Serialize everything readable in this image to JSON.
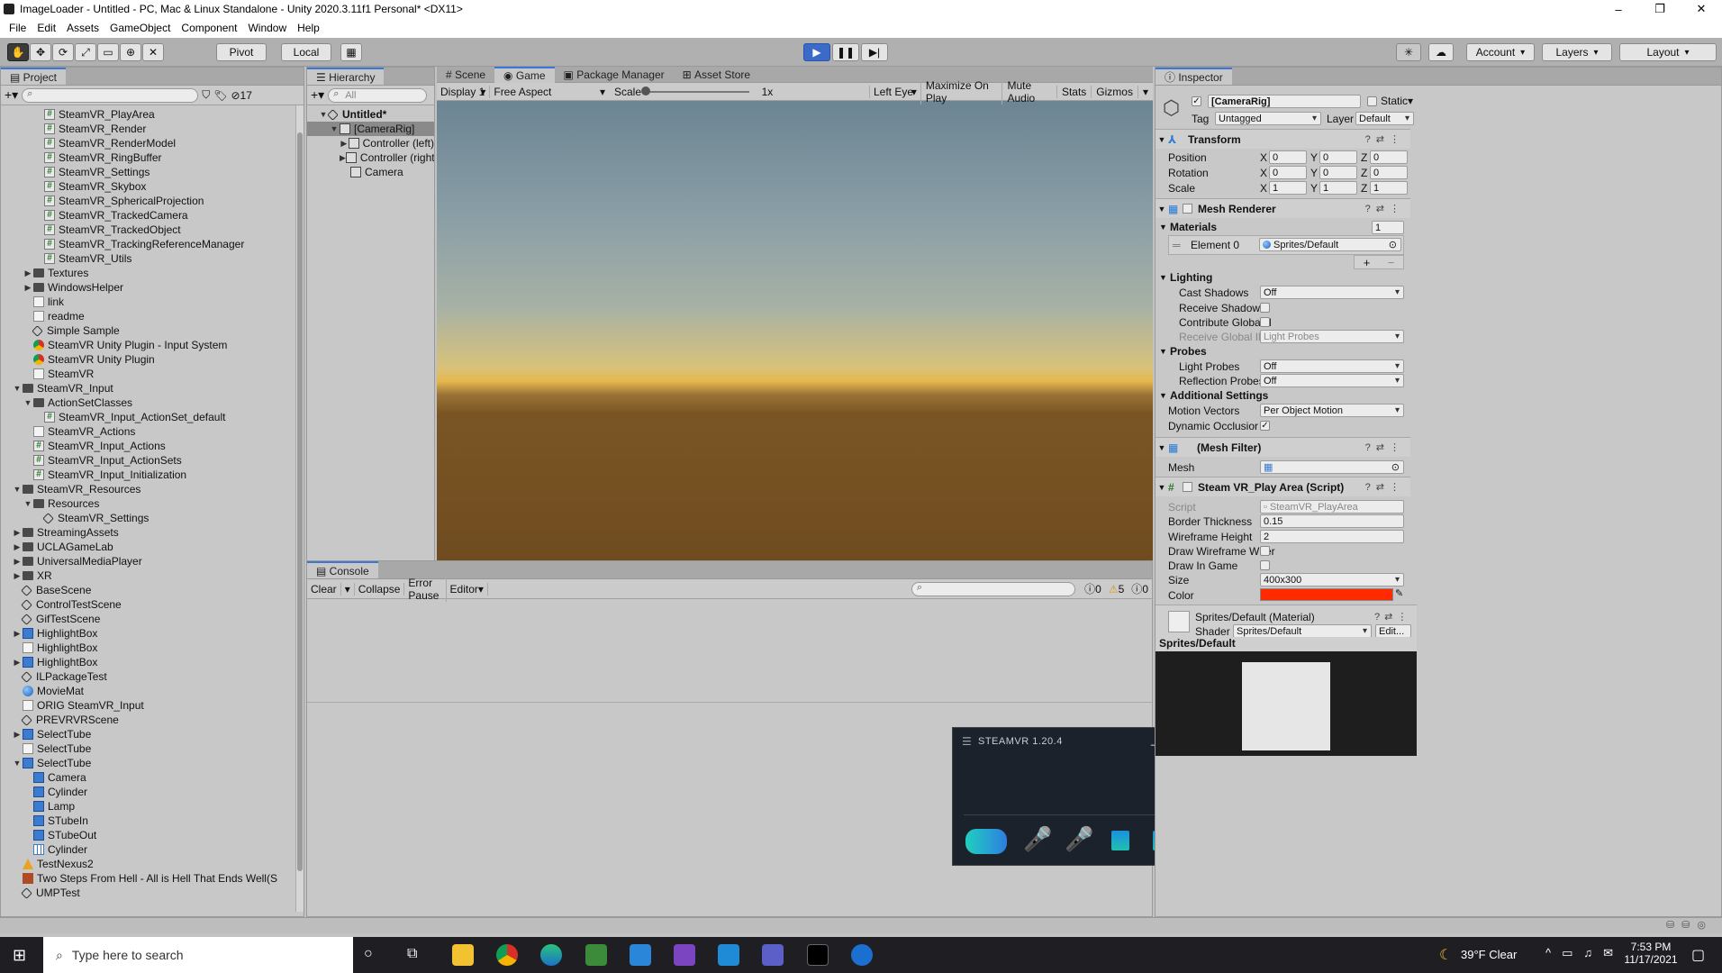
{
  "window": {
    "title": "ImageLoader - Untitled - PC, Mac & Linux Standalone - Unity 2020.3.11f1 Personal* <DX11>",
    "controls": [
      "–",
      "❐",
      "✕"
    ]
  },
  "menu": [
    "File",
    "Edit",
    "Assets",
    "GameObject",
    "Component",
    "Window",
    "Help"
  ],
  "toolbar": {
    "pivot": "Pivot",
    "local": "Local",
    "account": "Account",
    "layers": "Layers",
    "layout": "Layout"
  },
  "project": {
    "tab": "Project",
    "hidden_count": "17",
    "items": [
      {
        "indent": 3,
        "icon": "cs",
        "label": "SteamVR_PlayArea"
      },
      {
        "indent": 3,
        "icon": "cs",
        "label": "SteamVR_Render"
      },
      {
        "indent": 3,
        "icon": "cs",
        "label": "SteamVR_RenderModel"
      },
      {
        "indent": 3,
        "icon": "cs",
        "label": "SteamVR_RingBuffer"
      },
      {
        "indent": 3,
        "icon": "cs",
        "label": "SteamVR_Settings"
      },
      {
        "indent": 3,
        "icon": "cs",
        "label": "SteamVR_Skybox"
      },
      {
        "indent": 3,
        "icon": "cs",
        "label": "SteamVR_SphericalProjection"
      },
      {
        "indent": 3,
        "icon": "cs",
        "label": "SteamVR_TrackedCamera"
      },
      {
        "indent": 3,
        "icon": "cs",
        "label": "SteamVR_TrackedObject"
      },
      {
        "indent": 3,
        "icon": "cs",
        "label": "SteamVR_TrackingReferenceManager"
      },
      {
        "indent": 3,
        "icon": "cs",
        "label": "SteamVR_Utils"
      },
      {
        "indent": 2,
        "icon": "folder",
        "arrow": "▶",
        "label": "Textures"
      },
      {
        "indent": 2,
        "icon": "folder",
        "arrow": "▶",
        "label": "WindowsHelper"
      },
      {
        "indent": 2,
        "icon": "doc",
        "label": "link"
      },
      {
        "indent": 2,
        "icon": "doc",
        "label": "readme"
      },
      {
        "indent": 2,
        "icon": "scene",
        "label": "Simple Sample"
      },
      {
        "indent": 2,
        "icon": "chrome",
        "label": "SteamVR Unity Plugin - Input System"
      },
      {
        "indent": 2,
        "icon": "chrome",
        "label": "SteamVR Unity Plugin"
      },
      {
        "indent": 2,
        "icon": "doc",
        "label": "SteamVR"
      },
      {
        "indent": 1,
        "icon": "folder",
        "arrow": "▼",
        "label": "SteamVR_Input"
      },
      {
        "indent": 2,
        "icon": "folder",
        "arrow": "▼",
        "label": "ActionSetClasses"
      },
      {
        "indent": 3,
        "icon": "cs",
        "label": "SteamVR_Input_ActionSet_default"
      },
      {
        "indent": 2,
        "icon": "doc",
        "label": "SteamVR_Actions"
      },
      {
        "indent": 2,
        "icon": "cs",
        "label": "SteamVR_Input_Actions"
      },
      {
        "indent": 2,
        "icon": "cs",
        "label": "SteamVR_Input_ActionSets"
      },
      {
        "indent": 2,
        "icon": "cs",
        "label": "SteamVR_Input_Initialization"
      },
      {
        "indent": 1,
        "icon": "folder",
        "arrow": "▼",
        "label": "SteamVR_Resources"
      },
      {
        "indent": 2,
        "icon": "folder",
        "arrow": "▼",
        "label": "Resources"
      },
      {
        "indent": 3,
        "icon": "scene",
        "label": "SteamVR_Settings"
      },
      {
        "indent": 1,
        "icon": "folder",
        "arrow": "▶",
        "label": "StreamingAssets"
      },
      {
        "indent": 1,
        "icon": "folder",
        "arrow": "▶",
        "label": "UCLAGameLab"
      },
      {
        "indent": 1,
        "icon": "folder",
        "arrow": "▶",
        "label": "UniversalMediaPlayer"
      },
      {
        "indent": 1,
        "icon": "folder",
        "arrow": "▶",
        "label": "XR"
      },
      {
        "indent": 1,
        "icon": "scene",
        "label": "BaseScene"
      },
      {
        "indent": 1,
        "icon": "scene",
        "label": "ControlTestScene"
      },
      {
        "indent": 1,
        "icon": "scene",
        "label": "GifTestScene"
      },
      {
        "indent": 1,
        "icon": "prefab",
        "arrow": "▶",
        "label": "HighlightBox"
      },
      {
        "indent": 1,
        "icon": "doc",
        "label": "HighlightBox"
      },
      {
        "indent": 1,
        "icon": "prefab",
        "arrow": "▶",
        "label": "HighlightBox"
      },
      {
        "indent": 1,
        "icon": "scene",
        "label": "ILPackageTest"
      },
      {
        "indent": 1,
        "icon": "mat",
        "label": "MovieMat"
      },
      {
        "indent": 1,
        "icon": "doc",
        "label": "ORIG SteamVR_Input"
      },
      {
        "indent": 1,
        "icon": "scene",
        "label": "PREVRVRScene"
      },
      {
        "indent": 1,
        "icon": "prefab",
        "arrow": "▶",
        "label": "SelectTube"
      },
      {
        "indent": 1,
        "icon": "doc",
        "label": "SelectTube"
      },
      {
        "indent": 1,
        "icon": "prefab",
        "arrow": "▼",
        "label": "SelectTube"
      },
      {
        "indent": 2,
        "icon": "prefab",
        "label": "Camera"
      },
      {
        "indent": 2,
        "icon": "prefab",
        "label": "Cylinder"
      },
      {
        "indent": 2,
        "icon": "prefab",
        "label": "Lamp"
      },
      {
        "indent": 2,
        "icon": "prefab",
        "label": "STubeIn"
      },
      {
        "indent": 2,
        "icon": "prefab",
        "label": "STubeOut"
      },
      {
        "indent": 2,
        "icon": "grid",
        "label": "Cylinder"
      },
      {
        "indent": 1,
        "icon": "warn",
        "label": "TestNexus2"
      },
      {
        "indent": 1,
        "icon": "audio",
        "label": "Two Steps From Hell - All is Hell That Ends Well(S"
      },
      {
        "indent": 1,
        "icon": "scene",
        "label": "UMPTest"
      }
    ]
  },
  "hierarchy": {
    "tab": "Hierarchy",
    "search_placeholder": "All",
    "items": [
      {
        "indent": 0,
        "arrow": "▼",
        "label": "Untitled*",
        "bold": true
      },
      {
        "indent": 1,
        "arrow": "▼",
        "label": "[CameraRig]",
        "selected": true
      },
      {
        "indent": 2,
        "arrow": "▶",
        "label": "Controller (left)"
      },
      {
        "indent": 2,
        "arrow": "▶",
        "label": "Controller (right)"
      },
      {
        "indent": 2,
        "arrow": "",
        "label": "Camera"
      }
    ]
  },
  "game": {
    "tabs": [
      "Scene",
      "Game",
      "Package Manager",
      "Asset Store"
    ],
    "active_tab": "Game",
    "display": "Display 1",
    "aspect": "Free Aspect",
    "scale_label": "Scale",
    "scale_value": "1x",
    "eye": "Left Eye",
    "maximize": "Maximize On Play",
    "mute": "Mute Audio",
    "stats": "Stats",
    "gizmos": "Gizmos"
  },
  "console": {
    "tab": "Console",
    "clear": "Clear",
    "collapse": "Collapse",
    "error_pause": "Error Pause",
    "editor": "Editor",
    "counts": {
      "info": "0",
      "warn": "5",
      "error": "0"
    }
  },
  "steamvr": {
    "title": "STEAMVR 1.20.4"
  },
  "inspector": {
    "tab": "Inspector",
    "object_name": "[CameraRig]",
    "static_label": "Static",
    "tag_label": "Tag",
    "tag_value": "Untagged",
    "layer_label": "Layer",
    "layer_value": "Default",
    "transform": {
      "title": "Transform",
      "rows": [
        {
          "label": "Position",
          "x": "0",
          "y": "0",
          "z": "0"
        },
        {
          "label": "Rotation",
          "x": "0",
          "y": "0",
          "z": "0"
        },
        {
          "label": "Scale",
          "x": "1",
          "y": "1",
          "z": "1"
        }
      ]
    },
    "mesh_renderer": {
      "title": "Mesh Renderer",
      "materials_label": "Materials",
      "materials_count": "1",
      "element_label": "Element 0",
      "element_value": "Sprites/Default",
      "lighting_label": "Lighting",
      "cast_shadows_label": "Cast Shadows",
      "cast_shadows_value": "Off",
      "receive_shadows_label": "Receive Shadows",
      "contribute_gi_label": "Contribute Global Il",
      "receive_gi_label": "Receive Global Illui",
      "receive_gi_value": "Light Probes",
      "probes_label": "Probes",
      "light_probes_label": "Light Probes",
      "light_probes_value": "Off",
      "reflection_probes_label": "Reflection Probes",
      "reflection_probes_value": "Off",
      "additional_label": "Additional Settings",
      "motion_vectors_label": "Motion Vectors",
      "motion_vectors_value": "Per Object Motion",
      "dynamic_occlusion_label": "Dynamic Occlusior"
    },
    "mesh_filter": {
      "title": "(Mesh Filter)",
      "mesh_label": "Mesh"
    },
    "play_area": {
      "title": "Steam VR_Play Area (Script)",
      "script_label": "Script",
      "script_value": "SteamVR_PlayArea",
      "border_label": "Border Thickness",
      "border_value": "0.15",
      "wireframe_label": "Wireframe Height",
      "wireframe_value": "2",
      "draw_wireframe_label": "Draw Wireframe Wher",
      "draw_in_game_label": "Draw In Game",
      "size_label": "Size",
      "size_value": "400x300",
      "color_label": "Color",
      "color_hex": "#ff2a00"
    },
    "material": {
      "title": "Sprites/Default (Material)",
      "shader_label": "Shader",
      "shader_value": "Sprites/Default",
      "edit": "Edit...",
      "preview_title": "Sprites/Default"
    }
  },
  "taskbar": {
    "search_placeholder": "Type here to search",
    "weather": "39°F  Clear",
    "time": "7:53 PM",
    "date": "11/17/2021"
  },
  "colors": {
    "accent": "#3a78d8",
    "play": "#3c6ac8",
    "taskbar": "#1f1f23"
  }
}
